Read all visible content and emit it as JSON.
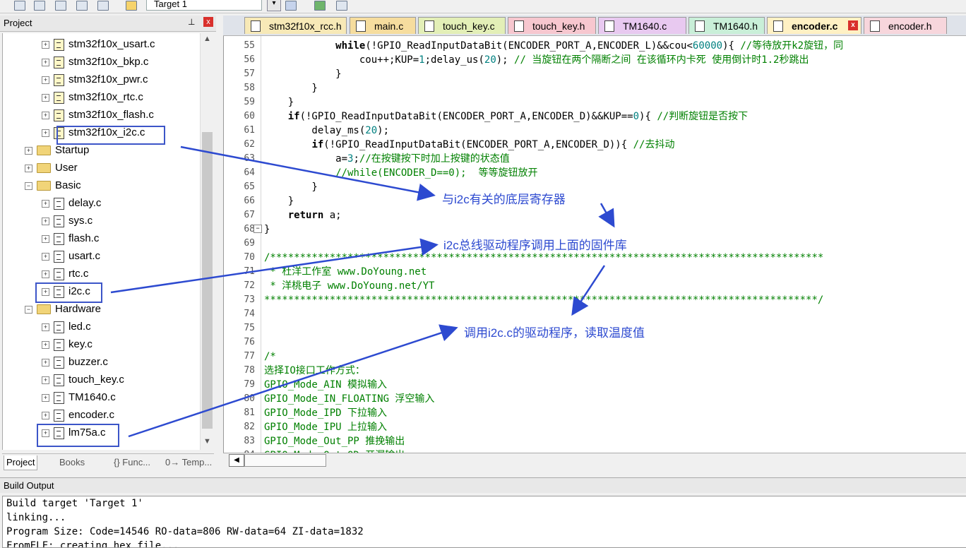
{
  "toolbar": {
    "target": "Target 1"
  },
  "project_panel": {
    "title": "Project",
    "pin": "ᵖ",
    "close": "x",
    "tree": [
      {
        "label": "stm32f10x_usart.c",
        "type": "file-locked",
        "indent": 3
      },
      {
        "label": "stm32f10x_bkp.c",
        "type": "file-locked",
        "indent": 3
      },
      {
        "label": "stm32f10x_pwr.c",
        "type": "file-locked",
        "indent": 3
      },
      {
        "label": "stm32f10x_rtc.c",
        "type": "file-locked",
        "indent": 3
      },
      {
        "label": "stm32f10x_flash.c",
        "type": "file-locked",
        "indent": 3
      },
      {
        "label": "stm32f10x_i2c.c",
        "type": "file-locked",
        "indent": 3
      },
      {
        "label": "Startup",
        "type": "folder",
        "indent": 2
      },
      {
        "label": "User",
        "type": "folder",
        "indent": 2
      },
      {
        "label": "Basic",
        "type": "folder-open",
        "indent": 2
      },
      {
        "label": "delay.c",
        "type": "file",
        "indent": 3
      },
      {
        "label": "sys.c",
        "type": "file",
        "indent": 3
      },
      {
        "label": "flash.c",
        "type": "file",
        "indent": 3
      },
      {
        "label": "usart.c",
        "type": "file",
        "indent": 3
      },
      {
        "label": "rtc.c",
        "type": "file",
        "indent": 3
      },
      {
        "label": "i2c.c",
        "type": "file",
        "indent": 3
      },
      {
        "label": "Hardware",
        "type": "folder-open",
        "indent": 2
      },
      {
        "label": "led.c",
        "type": "file",
        "indent": 3
      },
      {
        "label": "key.c",
        "type": "file",
        "indent": 3
      },
      {
        "label": "buzzer.c",
        "type": "file",
        "indent": 3
      },
      {
        "label": "touch_key.c",
        "type": "file",
        "indent": 3
      },
      {
        "label": "TM1640.c",
        "type": "file",
        "indent": 3
      },
      {
        "label": "encoder.c",
        "type": "file",
        "indent": 3
      },
      {
        "label": "lm75a.c",
        "type": "file",
        "indent": 3
      }
    ],
    "tabs": [
      "Project",
      "Books",
      "{} Func...",
      "0→ Temp..."
    ]
  },
  "editor_tabs": [
    {
      "label": "stm32f10x_rcc.h",
      "color": "#f7e9b7",
      "active": false
    },
    {
      "label": "main.c",
      "color": "#f6dd9e",
      "active": false
    },
    {
      "label": "touch_key.c",
      "color": "#e3efb7",
      "active": false
    },
    {
      "label": "touch_key.h",
      "color": "#f7c7cf",
      "active": false
    },
    {
      "label": "TM1640.c",
      "color": "#e8c9f0",
      "active": false
    },
    {
      "label": "TM1640.h",
      "color": "#c9efd8",
      "active": false
    },
    {
      "label": "encoder.c",
      "color": "#fff1c4",
      "active": true
    },
    {
      "label": "encoder.h",
      "color": "#f7d6dc",
      "active": false
    }
  ],
  "code_lines": [
    {
      "n": "55",
      "html": "            <span class='c-kw'>while</span>(!GPIO_ReadInputDataBit(ENCODER_PORT_A,ENCODER_L)&amp;&amp;cou&lt;<span class='c-teal'>60000</span>){ <span class='c-green'>//等待放开k2旋钮，同</span>"
    },
    {
      "n": "56",
      "html": "                cou++;KUP=<span class='c-teal'>1</span>;delay_us(<span class='c-teal'>20</span>); <span class='c-green'>// 当旋钮在两个隔断之间 在该循环内卡死 使用倒计时1.2秒跳出</span>"
    },
    {
      "n": "57",
      "html": "            }"
    },
    {
      "n": "58",
      "html": "        }"
    },
    {
      "n": "59",
      "html": "    }"
    },
    {
      "n": "60",
      "html": "    <span class='c-kw'>if</span>(!GPIO_ReadInputDataBit(ENCODER_PORT_A,ENCODER_D)&amp;&amp;KUP==<span class='c-teal'>0</span>){ <span class='c-green'>//判断旋钮是否按下</span>"
    },
    {
      "n": "61",
      "html": "        delay_ms(<span class='c-teal'>20</span>);"
    },
    {
      "n": "62",
      "html": "        <span class='c-kw'>if</span>(!GPIO_ReadInputDataBit(ENCODER_PORT_A,ENCODER_D)){ <span class='c-green'>//去抖动</span>"
    },
    {
      "n": "63",
      "html": "            a=<span class='c-teal'>3</span>;<span class='c-green'>//在按键按下时加上按键的状态值</span>"
    },
    {
      "n": "64",
      "html": "            <span class='c-green'>//while(ENCODER_D==0);  等等旋钮放开</span>"
    },
    {
      "n": "65",
      "html": "        }"
    },
    {
      "n": "66",
      "html": "    }"
    },
    {
      "n": "67",
      "html": "    <span class='c-kw'>return</span> a;"
    },
    {
      "n": "68",
      "html": "}"
    },
    {
      "n": "69",
      "html": ""
    },
    {
      "n": "70",
      "html": "<span class='c-green'>/*********************************************************************************************</span>"
    },
    {
      "n": "71",
      "html": "<span class='c-green'> * 杜洋工作室 www.DoYoung.net</span>"
    },
    {
      "n": "72",
      "html": "<span class='c-green'> * 洋桃电子 www.DoYoung.net/YT</span>"
    },
    {
      "n": "73",
      "html": "<span class='c-green'>*********************************************************************************************/</span>"
    },
    {
      "n": "74",
      "html": ""
    },
    {
      "n": "75",
      "html": ""
    },
    {
      "n": "76",
      "html": ""
    },
    {
      "n": "77",
      "html": "<span class='c-green'>/*</span>"
    },
    {
      "n": "78",
      "html": "<span class='c-green'>选择IO接口工作方式：</span>"
    },
    {
      "n": "79",
      "html": "<span class='c-green'>GPIO_Mode_AIN 模拟输入</span>"
    },
    {
      "n": "80",
      "html": "<span class='c-green'>GPIO_Mode_IN_FLOATING 浮空输入</span>"
    },
    {
      "n": "81",
      "html": "<span class='c-green'>GPIO_Mode_IPD 下拉输入</span>"
    },
    {
      "n": "82",
      "html": "<span class='c-green'>GPIO_Mode_IPU 上拉输入</span>"
    },
    {
      "n": "83",
      "html": "<span class='c-green'>GPIO_Mode_Out_PP 推挽输出</span>"
    },
    {
      "n": "84",
      "html": "<span class='c-green'>GPIO_Mode_Out_OD 开漏输出</span>"
    }
  ],
  "annotations": {
    "a1": "与i2c有关的底层寄存器",
    "a2": "i2c总线驱动程序调用上面的固件库",
    "a3": "调用i2c.c的驱动程序，读取温度值"
  },
  "build": {
    "title": "Build Output",
    "lines": [
      "Build target 'Target 1'",
      "linking...",
      "Program Size: Code=14546 RO-data=806 RW-data=64 ZI-data=1832",
      "FromELF: creating hex file..."
    ]
  }
}
